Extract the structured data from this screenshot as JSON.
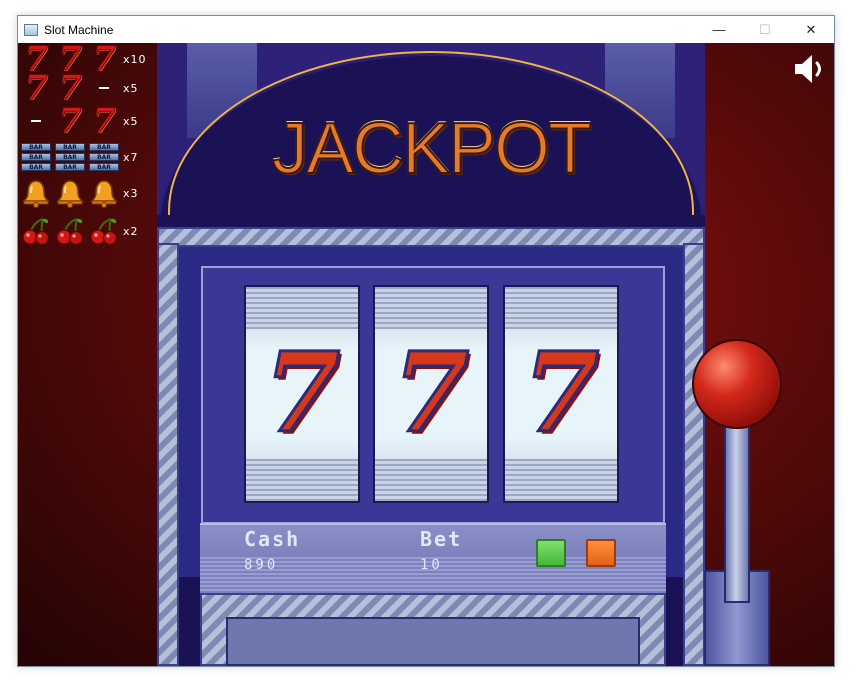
{
  "window": {
    "title": "Slot Machine",
    "controls": {
      "minimize": "—",
      "maximize": "☐",
      "close": "✕"
    }
  },
  "paytable": [
    {
      "symbols": [
        "7",
        "7",
        "7"
      ],
      "payout": "x10"
    },
    {
      "symbols": [
        "7",
        "7",
        "-"
      ],
      "payout": "x5"
    },
    {
      "symbols": [
        "-",
        "7",
        "7"
      ],
      "payout": "x5"
    },
    {
      "symbols": [
        "BAR",
        "BAR",
        "BAR"
      ],
      "payout": "x7"
    },
    {
      "symbols": [
        "bell",
        "bell",
        "bell"
      ],
      "payout": "x3"
    },
    {
      "symbols": [
        "cherry",
        "cherry",
        "cherry"
      ],
      "payout": "x2"
    }
  ],
  "bar_text": "BAR",
  "machine": {
    "title": "JACKPOT",
    "reels": [
      "7",
      "7",
      "7"
    ]
  },
  "control_panel": {
    "cash_label": "Cash",
    "cash_value": "890",
    "bet_label": "Bet",
    "bet_value": "10"
  },
  "icons": {
    "sound": "speaker-icon",
    "app": "window-app-icon"
  },
  "colors": {
    "background_red": "#8a1212",
    "cabinet_navy": "#1b1256",
    "jackpot_orange": "#e57a2b",
    "green_button": "#46b83a",
    "orange_button": "#e2631a",
    "lever_knob_red": "#d2281a"
  }
}
